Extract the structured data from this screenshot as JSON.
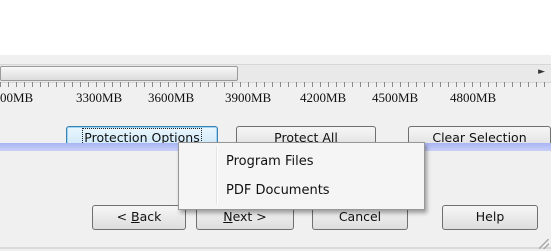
{
  "ruler": {
    "labels": [
      "00MB",
      "3300MB",
      "3600MB",
      "3900MB",
      "4200MB",
      "4500MB",
      "4800MB"
    ]
  },
  "buttons": {
    "protection_options": "Protection Options",
    "protect_all": "Protect All",
    "clear_selection": "Clear Selection",
    "back_prefix": "< ",
    "back_key": "B",
    "back_rest": "ack",
    "next_key": "N",
    "next_rest": "ext >",
    "cancel": "Cancel",
    "help": "Help"
  },
  "context_menu": {
    "items": [
      "Program Files",
      "PDF Documents"
    ]
  }
}
